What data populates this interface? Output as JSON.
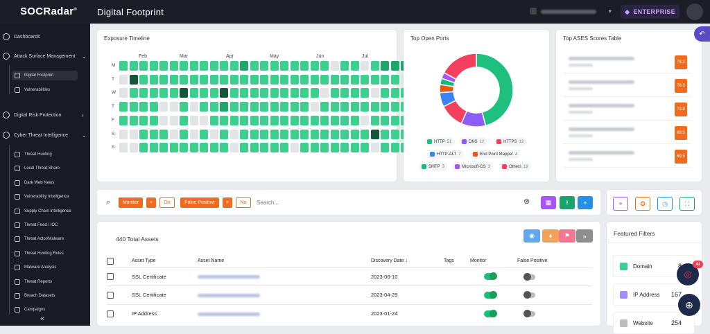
{
  "app": {
    "brand": "SOCRadar",
    "brand_mark": "®",
    "page_title": "Digital Footprint",
    "plan_label": "ENTERPRISE"
  },
  "sidebar": {
    "sections": [
      {
        "label": "Dashboards",
        "icon": "dashboard-icon"
      },
      {
        "label": "Attack Surface Management",
        "icon": "attack-surface-icon"
      },
      {
        "label": "Digital Risk Protection",
        "icon": "risk-icon"
      },
      {
        "label": "Cyber Threat Intelligence",
        "icon": "intel-icon"
      }
    ],
    "asm_items": [
      "Digital Footprint",
      "Vulnerabilities"
    ],
    "cti_items": [
      "Threat Hunting",
      "Local Threat Share",
      "Dark Web News",
      "Vulnerability Intelligence",
      "Supply Chain Intelligence",
      "Threat Feed / IOC",
      "Threat Actor/Malware",
      "Threat Hunting Rules",
      "Malware Analysis",
      "Threat Reports",
      "Breach Datasets",
      "Campaigns"
    ]
  },
  "exposure": {
    "title": "Exposure Timeline",
    "months": [
      "Feb",
      "Mar",
      "Apr",
      "May",
      "Jun",
      "Jul"
    ],
    "days": [
      "M",
      "T",
      "W",
      "T",
      "F",
      "S",
      "S"
    ],
    "colors": {
      "empty": "#e2e4e6",
      "low": "#3ccf8e",
      "mid": "#1ea76a",
      "high": "#16563b"
    },
    "grid": [
      "1111111111112111111110110122222222",
      "0311111111111111111111111111012222",
      "0111113111311111111101111011111121",
      "1111001011211111111011111111111111",
      "1111001001111111111111110111111111",
      "0011101010101111111111111311111111",
      "0011111111101111101111111011111111"
    ]
  },
  "ports": {
    "title": "Top Open Ports",
    "items": [
      {
        "name": "HTTP",
        "count": 51,
        "color": "#1ebf7f"
      },
      {
        "name": "DNS",
        "count": 12,
        "color": "#8b5cf6"
      },
      {
        "name": "HTTPS",
        "count": 12,
        "color": "#f43f5e"
      },
      {
        "name": "HTTP-ALT",
        "count": 7,
        "color": "#3b82f6"
      },
      {
        "name": "End Point Mapper",
        "count": 4,
        "color": "#ea580c"
      },
      {
        "name": "SMTP",
        "count": 3,
        "color": "#10b981"
      },
      {
        "name": "Microsoft-DS",
        "count": 3,
        "color": "#a855f7"
      },
      {
        "name": "Others",
        "count": 19,
        "color": "#f43f5e"
      }
    ]
  },
  "ases": {
    "title": "Top ASES Scores Table",
    "scores": [
      "78.2",
      "78.3",
      "73.8",
      "69.5",
      "69.5"
    ]
  },
  "filters": {
    "monitor_label": "Monitor",
    "monitor_clear": "×",
    "monitor_value": "On",
    "fp_label": "False Positive",
    "fp_clear": "×",
    "fp_value": "No",
    "search_placeholder": "Search...",
    "clear_icon": "⊗"
  },
  "assets": {
    "total_label": "440 Total Assets",
    "columns": [
      "Asset Type",
      "Asset Name",
      "Discovery Date",
      "Tags",
      "Monitor",
      "False Positive"
    ],
    "sort_indicator": "↓",
    "rows": [
      {
        "type": "SSL Certificate",
        "date": "2023-06-10"
      },
      {
        "type": "SSL Certificate",
        "date": "2023-04-29"
      },
      {
        "type": "IP Address",
        "date": "2023-01-24"
      }
    ]
  },
  "featured": {
    "title": "Featured Filters",
    "items": [
      {
        "label": "Domain",
        "count": "8",
        "color": "#3ccf8e"
      },
      {
        "label": "IP Address",
        "count": "167",
        "color": "#a78bfa"
      },
      {
        "label": "Website",
        "count": "254",
        "color": "#bdbdbd"
      }
    ]
  },
  "misc": {
    "ai_badge": "AI"
  }
}
